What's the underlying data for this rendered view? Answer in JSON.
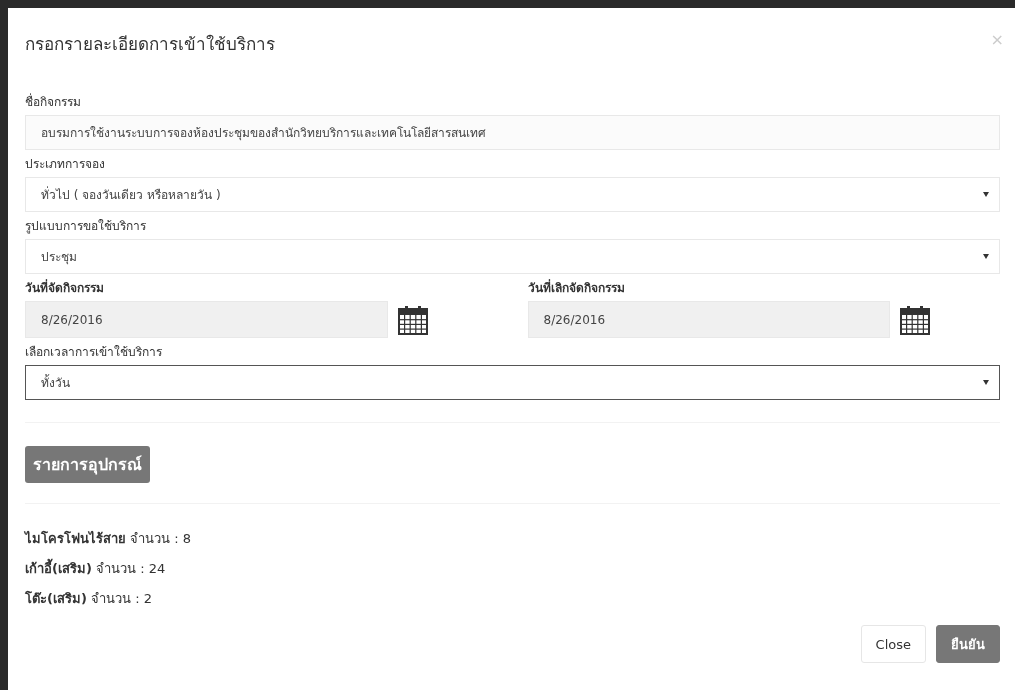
{
  "modal": {
    "title": "กรอกรายละเอียดการเข้าใช้บริการ",
    "close_icon": "×"
  },
  "rows": [
    {
      "kind": "full",
      "fields": [
        {
          "label": "ชื่อกิจกรรม",
          "kind": "input",
          "value": "อบรมการใช้งานระบบการจองห้องประชุมของสำนักวิทยบริการและเทคโนโลยีสารสนเทศ",
          "focused": false
        }
      ]
    },
    {
      "kind": "full",
      "fields": [
        {
          "label": "ประเภทการจอง",
          "kind": "select",
          "value": "ทั่วไป ( จองวันเดียว หรือหลายวัน )",
          "focused": false
        }
      ]
    },
    {
      "kind": "full",
      "fields": [
        {
          "label": "รูปแบบการขอใช้บริการ",
          "kind": "select",
          "value": "ประชุม",
          "focused": false
        }
      ]
    },
    {
      "kind": "split",
      "fields": [
        {
          "label": "วันที่จัดกิจกรรม",
          "kind": "date",
          "value": "8/26/2016",
          "focused": false
        },
        {
          "label": "วันที่เลิกจัดกิจกรรม",
          "kind": "date",
          "value": "8/26/2016",
          "focused": false
        }
      ]
    },
    {
      "kind": "full",
      "fields": [
        {
          "label": "เลือกเวลาการเข้าใช้บริการ",
          "kind": "select",
          "value": "ทั้งวัน",
          "focused": true
        }
      ]
    }
  ],
  "equipment": {
    "heading": "รายการอุปกรณ์",
    "items": [
      "**ไมโครโฟนไร้สาย** จำนวน : 8",
      "**เก้าอี้(เสริม)** จำนวน : 24",
      "**โต๊ะ(เสริม)** จำนวน : 2"
    ]
  },
  "buttons": [
    {
      "label": "Close",
      "kind": "default"
    },
    {
      "label": "ยืนยัน",
      "kind": "primary"
    }
  ]
}
